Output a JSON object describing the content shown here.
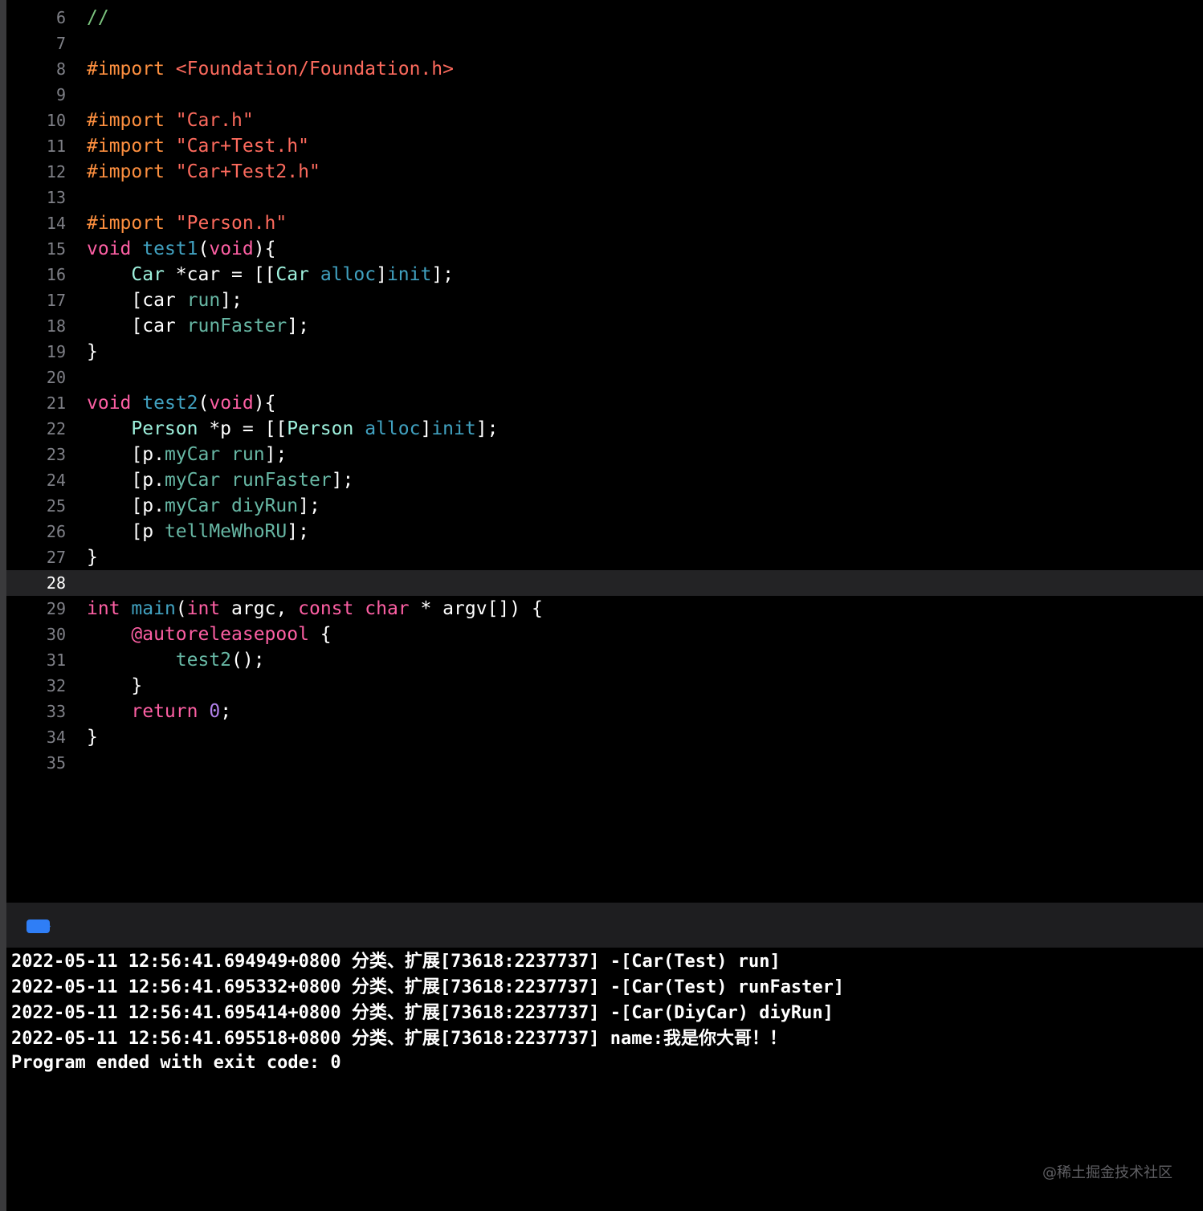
{
  "editor": {
    "current_line": "28",
    "lines": [
      {
        "num": "6",
        "tokens": [
          {
            "t": "//",
            "c": "comment"
          }
        ]
      },
      {
        "num": "7",
        "tokens": []
      },
      {
        "num": "8",
        "tokens": [
          {
            "t": "#import ",
            "c": "directive"
          },
          {
            "t": "<Foundation/Foundation.h>",
            "c": "string"
          }
        ]
      },
      {
        "num": "9",
        "tokens": []
      },
      {
        "num": "10",
        "tokens": [
          {
            "t": "#import ",
            "c": "directive"
          },
          {
            "t": "\"Car.h\"",
            "c": "string"
          }
        ]
      },
      {
        "num": "11",
        "tokens": [
          {
            "t": "#import ",
            "c": "directive"
          },
          {
            "t": "\"Car+Test.h\"",
            "c": "string"
          }
        ]
      },
      {
        "num": "12",
        "tokens": [
          {
            "t": "#import ",
            "c": "directive"
          },
          {
            "t": "\"Car+Test2.h\"",
            "c": "string"
          }
        ]
      },
      {
        "num": "13",
        "tokens": []
      },
      {
        "num": "14",
        "tokens": [
          {
            "t": "#import ",
            "c": "directive"
          },
          {
            "t": "\"Person.h\"",
            "c": "string"
          }
        ]
      },
      {
        "num": "15",
        "tokens": [
          {
            "t": "void",
            "c": "keyword"
          },
          {
            "t": " ",
            "c": "plain"
          },
          {
            "t": "test1",
            "c": "sysmethod"
          },
          {
            "t": "(",
            "c": "plain"
          },
          {
            "t": "void",
            "c": "keyword"
          },
          {
            "t": "){",
            "c": "plain"
          }
        ]
      },
      {
        "num": "16",
        "tokens": [
          {
            "t": "    ",
            "c": "plain"
          },
          {
            "t": "Car",
            "c": "projtype"
          },
          {
            "t": " *car = [[",
            "c": "plain"
          },
          {
            "t": "Car",
            "c": "projtype"
          },
          {
            "t": " ",
            "c": "plain"
          },
          {
            "t": "alloc",
            "c": "sysmethod"
          },
          {
            "t": "]",
            "c": "plain"
          },
          {
            "t": "init",
            "c": "sysmethod"
          },
          {
            "t": "];",
            "c": "plain"
          }
        ]
      },
      {
        "num": "17",
        "tokens": [
          {
            "t": "    [car ",
            "c": "plain"
          },
          {
            "t": "run",
            "c": "projmethod"
          },
          {
            "t": "];",
            "c": "plain"
          }
        ]
      },
      {
        "num": "18",
        "tokens": [
          {
            "t": "    [car ",
            "c": "plain"
          },
          {
            "t": "runFaster",
            "c": "projmethod"
          },
          {
            "t": "];",
            "c": "plain"
          }
        ]
      },
      {
        "num": "19",
        "tokens": [
          {
            "t": "}",
            "c": "plain"
          }
        ]
      },
      {
        "num": "20",
        "tokens": []
      },
      {
        "num": "21",
        "tokens": [
          {
            "t": "void",
            "c": "keyword"
          },
          {
            "t": " ",
            "c": "plain"
          },
          {
            "t": "test2",
            "c": "sysmethod"
          },
          {
            "t": "(",
            "c": "plain"
          },
          {
            "t": "void",
            "c": "keyword"
          },
          {
            "t": "){",
            "c": "plain"
          }
        ]
      },
      {
        "num": "22",
        "tokens": [
          {
            "t": "    ",
            "c": "plain"
          },
          {
            "t": "Person",
            "c": "projtype"
          },
          {
            "t": " *p = [[",
            "c": "plain"
          },
          {
            "t": "Person",
            "c": "projtype"
          },
          {
            "t": " ",
            "c": "plain"
          },
          {
            "t": "alloc",
            "c": "sysmethod"
          },
          {
            "t": "]",
            "c": "plain"
          },
          {
            "t": "init",
            "c": "sysmethod"
          },
          {
            "t": "];",
            "c": "plain"
          }
        ]
      },
      {
        "num": "23",
        "tokens": [
          {
            "t": "    [p.",
            "c": "plain"
          },
          {
            "t": "myCar",
            "c": "projmethod"
          },
          {
            "t": " ",
            "c": "plain"
          },
          {
            "t": "run",
            "c": "projmethod"
          },
          {
            "t": "];",
            "c": "plain"
          }
        ]
      },
      {
        "num": "24",
        "tokens": [
          {
            "t": "    [p.",
            "c": "plain"
          },
          {
            "t": "myCar",
            "c": "projmethod"
          },
          {
            "t": " ",
            "c": "plain"
          },
          {
            "t": "runFaster",
            "c": "projmethod"
          },
          {
            "t": "];",
            "c": "plain"
          }
        ]
      },
      {
        "num": "25",
        "tokens": [
          {
            "t": "    [p.",
            "c": "plain"
          },
          {
            "t": "myCar",
            "c": "projmethod"
          },
          {
            "t": " ",
            "c": "plain"
          },
          {
            "t": "diyRun",
            "c": "projmethod"
          },
          {
            "t": "];",
            "c": "plain"
          }
        ]
      },
      {
        "num": "26",
        "tokens": [
          {
            "t": "    [p ",
            "c": "plain"
          },
          {
            "t": "tellMeWhoRU",
            "c": "projmethod"
          },
          {
            "t": "];",
            "c": "plain"
          }
        ]
      },
      {
        "num": "27",
        "tokens": [
          {
            "t": "}",
            "c": "plain"
          }
        ]
      },
      {
        "num": "28",
        "tokens": []
      },
      {
        "num": "29",
        "tokens": [
          {
            "t": "int",
            "c": "keyword"
          },
          {
            "t": " ",
            "c": "plain"
          },
          {
            "t": "main",
            "c": "sysmethod"
          },
          {
            "t": "(",
            "c": "plain"
          },
          {
            "t": "int",
            "c": "keyword"
          },
          {
            "t": " argc, ",
            "c": "plain"
          },
          {
            "t": "const",
            "c": "keyword"
          },
          {
            "t": " ",
            "c": "plain"
          },
          {
            "t": "char",
            "c": "keyword"
          },
          {
            "t": " * argv[]) {",
            "c": "plain"
          }
        ]
      },
      {
        "num": "30",
        "tokens": [
          {
            "t": "    ",
            "c": "plain"
          },
          {
            "t": "@autoreleasepool",
            "c": "keyword"
          },
          {
            "t": " {",
            "c": "plain"
          }
        ]
      },
      {
        "num": "31",
        "tokens": [
          {
            "t": "        ",
            "c": "plain"
          },
          {
            "t": "test2",
            "c": "projmethod"
          },
          {
            "t": "();",
            "c": "plain"
          }
        ]
      },
      {
        "num": "32",
        "tokens": [
          {
            "t": "    }",
            "c": "plain"
          }
        ]
      },
      {
        "num": "33",
        "tokens": [
          {
            "t": "    ",
            "c": "plain"
          },
          {
            "t": "return",
            "c": "keyword"
          },
          {
            "t": " ",
            "c": "plain"
          },
          {
            "t": "0",
            "c": "num-purple"
          },
          {
            "t": ";",
            "c": "plain"
          }
        ]
      },
      {
        "num": "34",
        "tokens": [
          {
            "t": "}",
            "c": "plain"
          }
        ]
      },
      {
        "num": "35",
        "tokens": []
      }
    ]
  },
  "console": {
    "lines": [
      "2022-05-11 12:56:41.694949+0800 分类、扩展[73618:2237737] -[Car(Test) run]",
      "2022-05-11 12:56:41.695332+0800 分类、扩展[73618:2237737] -[Car(Test) runFaster]",
      "2022-05-11 12:56:41.695414+0800 分类、扩展[73618:2237737] -[Car(DiyCar) diyRun]",
      "2022-05-11 12:56:41.695518+0800 分类、扩展[73618:2237737] name:我是你大哥！！",
      "Program ended with exit code: 0"
    ]
  },
  "watermark": "@稀土掘金技术社区",
  "colors": {
    "background": "#000000",
    "current_line": "#232325",
    "console_toggle": "#2f7ef6",
    "keyword": "#fc5fa3",
    "directive": "#fd8f3f",
    "string": "#fc6a5d",
    "comment": "#7cc47f",
    "project_type": "#9ef1dd",
    "project_method": "#67b7a4",
    "system_method": "#41a1c0",
    "number": "#b281eb"
  }
}
